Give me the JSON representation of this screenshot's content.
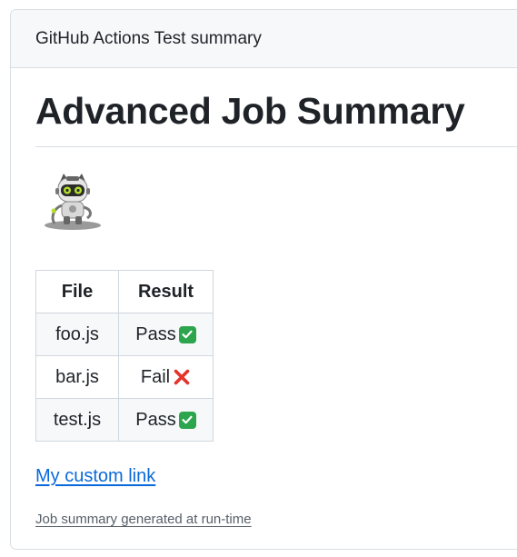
{
  "header": {
    "title": "GitHub Actions Test summary"
  },
  "summary": {
    "heading": "Advanced Job Summary",
    "mascot_icon": "octocat-robot-icon",
    "table": {
      "columns": [
        "File",
        "Result"
      ],
      "rows": [
        {
          "file": "foo.js",
          "result": "Pass",
          "status_icon": "check-mark-icon"
        },
        {
          "file": "bar.js",
          "result": "Fail",
          "status_icon": "cross-mark-icon"
        },
        {
          "file": "test.js",
          "result": "Pass",
          "status_icon": "check-mark-icon"
        }
      ]
    },
    "link_label": "My custom link",
    "footnote": "Job summary generated at run-time"
  },
  "colors": {
    "link": "#0969da",
    "pass": "#2da44e",
    "fail": "#e5332a",
    "border": "#d0d7de"
  }
}
